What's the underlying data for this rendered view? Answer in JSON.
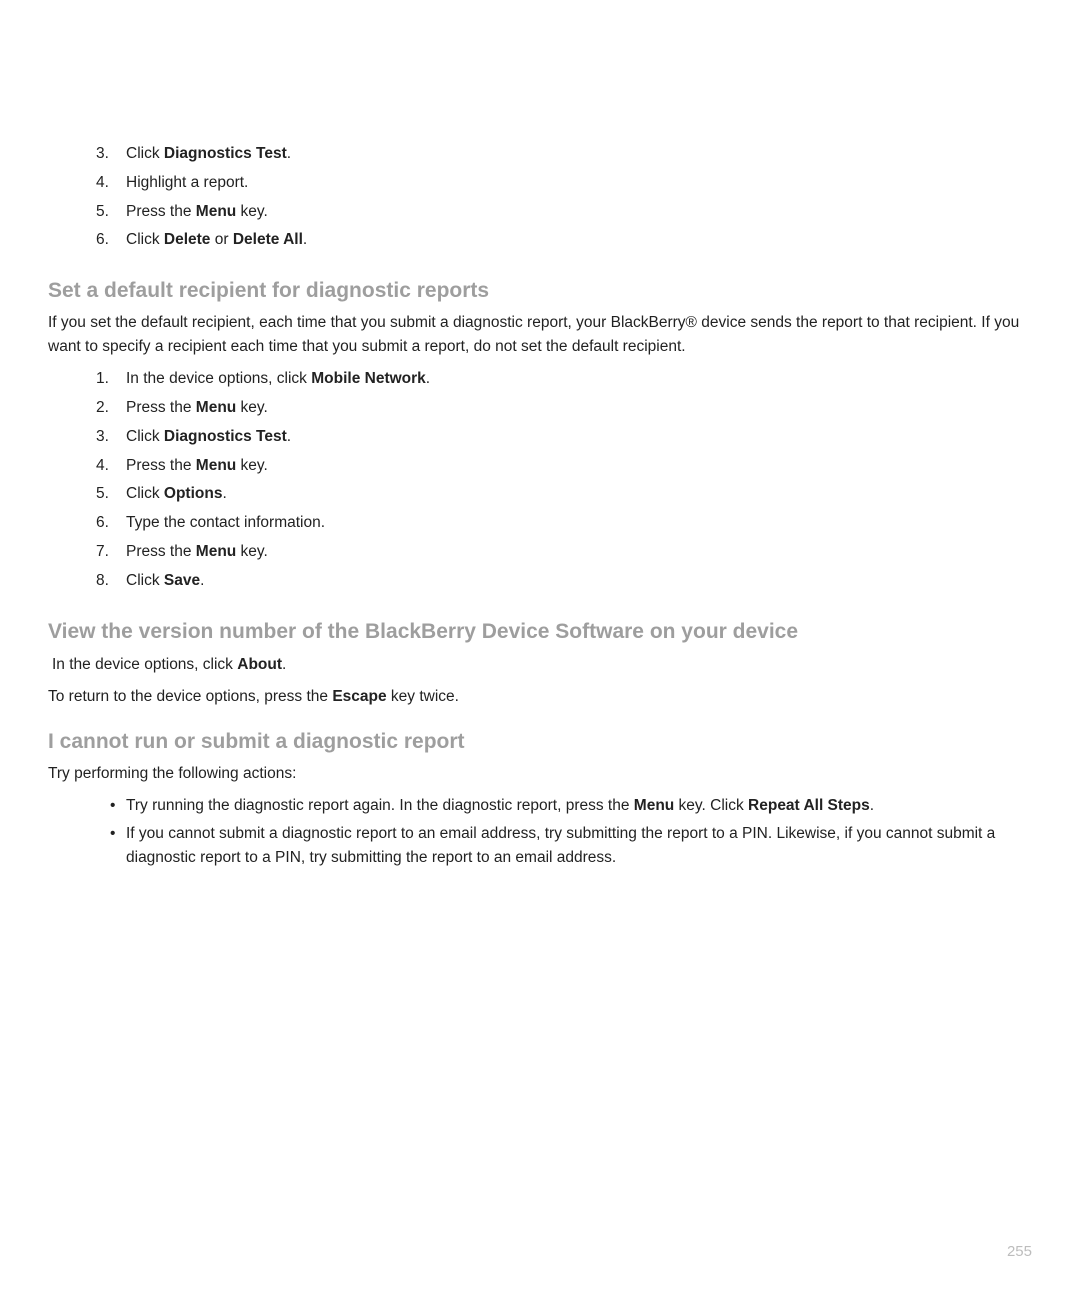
{
  "olA": [
    {
      "num": "3.",
      "pre": "Click ",
      "b1": "Diagnostics Test",
      "post": "."
    },
    {
      "num": "4.",
      "pre": "Highlight a report."
    },
    {
      "num": "5.",
      "pre": "Press the ",
      "b1": "Menu",
      "post": " key."
    },
    {
      "num": "6.",
      "pre": "Click ",
      "b1": "Delete",
      "mid": " or ",
      "b2": "Delete All",
      "post": "."
    }
  ],
  "sec1": {
    "heading": "Set a default recipient for diagnostic reports",
    "intro": "If you set the default recipient, each time that you submit a diagnostic report, your BlackBerry® device sends the report to that recipient. If you want to specify a recipient each time that you submit a report, do not set the default recipient.",
    "ol": [
      {
        "num": "1.",
        "pre": "In the device options, click ",
        "b1": "Mobile Network",
        "post": "."
      },
      {
        "num": "2.",
        "pre": "Press the ",
        "b1": "Menu",
        "post": " key."
      },
      {
        "num": "3.",
        "pre": "Click ",
        "b1": "Diagnostics Test",
        "post": "."
      },
      {
        "num": "4.",
        "pre": "Press the ",
        "b1": "Menu",
        "post": " key."
      },
      {
        "num": "5.",
        "pre": "Click ",
        "b1": "Options",
        "post": "."
      },
      {
        "num": "6.",
        "pre": "Type the contact information."
      },
      {
        "num": "7.",
        "pre": "Press the ",
        "b1": "Menu",
        "post": " key."
      },
      {
        "num": "8.",
        "pre": "Click ",
        "b1": "Save",
        "post": "."
      }
    ]
  },
  "sec2": {
    "heading": "View the version number of the BlackBerry Device Software on your device",
    "p1_pre": "In the device options, click ",
    "p1_b": "About",
    "p1_post": ".",
    "p2_pre": "To return to the device options, press the ",
    "p2_b": "Escape",
    "p2_post": " key twice."
  },
  "sec3": {
    "heading": "I cannot run or submit a diagnostic report",
    "intro": "Try performing the following actions:",
    "ul": [
      {
        "pre": "Try running the diagnostic report again. In the diagnostic report, press the ",
        "b1": "Menu",
        "mid": " key. Click ",
        "b2": "Repeat All Steps",
        "post": "."
      },
      {
        "pre": "If you cannot submit a diagnostic report to an email address, try submitting the report to a PIN. Likewise, if you cannot submit a diagnostic report to a PIN, try submitting the report to an email address."
      }
    ]
  },
  "pagenum": "255"
}
